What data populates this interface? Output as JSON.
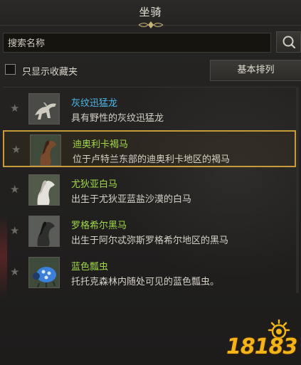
{
  "header": {
    "title": "坐骑"
  },
  "search": {
    "placeholder": "搜索名称"
  },
  "filter": {
    "favorites_only_label": "只显示收藏夹",
    "sort_button_label": "基本排列"
  },
  "colors": {
    "name_blue": "#4db8e8",
    "name_green": "#9fd84a",
    "selected_border": "#c99a3a",
    "watermark": "#f3b418"
  },
  "mounts": [
    {
      "name": "灰纹迅猛龙",
      "description": "具有野性的灰纹迅猛龙",
      "name_color": "blue",
      "favorite": false,
      "selected": false,
      "icon": "raptor-icon"
    },
    {
      "name": "迪奥利卡褐马",
      "description": "位于卢特兰东部的迪奥利卡地区的褐马",
      "name_color": "green",
      "favorite": false,
      "selected": true,
      "icon": "brown-horse-icon"
    },
    {
      "name": "尤狄亚白马",
      "description": "出生于尤狄亚蓝盐沙漠的白马",
      "name_color": "green",
      "favorite": false,
      "selected": false,
      "icon": "white-horse-icon"
    },
    {
      "name": "罗格希尔黑马",
      "description": "出生于阿尔忒弥斯罗格希尔地区的黑马",
      "name_color": "green",
      "favorite": false,
      "selected": false,
      "icon": "black-horse-icon"
    },
    {
      "name": "蓝色瓢虫",
      "description": "托托克森林内随处可见的蓝色瓢虫。",
      "name_color": "green",
      "favorite": false,
      "selected": false,
      "icon": "ladybug-icon"
    }
  ],
  "watermark": {
    "text": "18183"
  }
}
